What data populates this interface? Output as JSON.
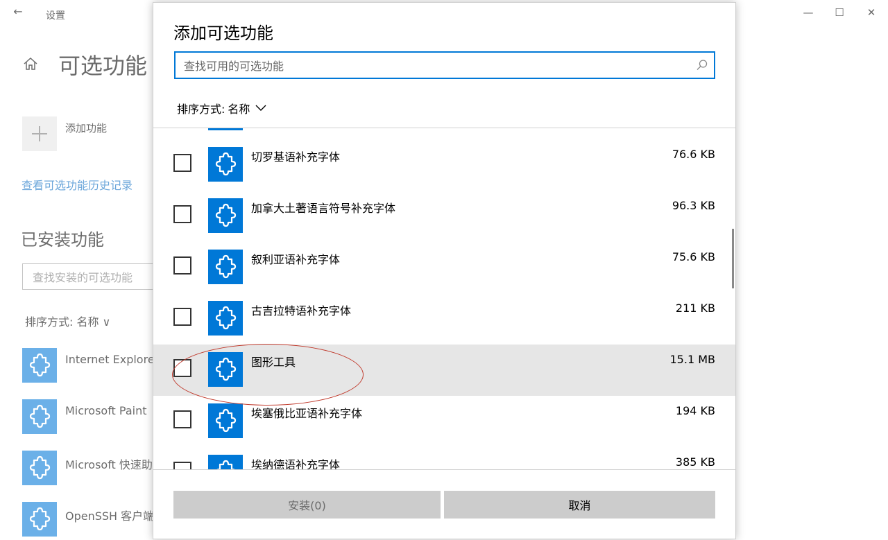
{
  "window": {
    "title": "设置",
    "back_glyph": "←",
    "minimize_glyph": "—",
    "maximize_glyph": "☐",
    "close_glyph": "✕"
  },
  "settings": {
    "page_title": "可选功能",
    "add_feature_label": "添加功能",
    "history_link": "查看可选功能历史记录",
    "installed_title": "已安装功能",
    "installed_search_placeholder": "查找安装的可选功能",
    "installed_sort": "排序方式: 名称 ∨",
    "installed_items": [
      {
        "name": "Internet Explorer"
      },
      {
        "name": "Microsoft Paint"
      },
      {
        "name": "Microsoft 快速助"
      },
      {
        "name": "OpenSSH 客户端"
      }
    ]
  },
  "dialog": {
    "title": "添加可选功能",
    "search_placeholder": "查找可用的可选功能",
    "sort_label": "排序方式:",
    "sort_value": "名称",
    "features": [
      {
        "name": "切罗基语补充字体",
        "size": "76.6 KB",
        "selected": false
      },
      {
        "name": "加拿大土著语言符号补充字体",
        "size": "96.3 KB",
        "selected": false
      },
      {
        "name": "叙利亚语补充字体",
        "size": "75.6 KB",
        "selected": false
      },
      {
        "name": "古吉拉特语补充字体",
        "size": "211 KB",
        "selected": false
      },
      {
        "name": "图形工具",
        "size": "15.1 MB",
        "selected": true
      },
      {
        "name": "埃塞俄比亚语补充字体",
        "size": "194 KB",
        "selected": false
      },
      {
        "name": "埃纳德语补充字体",
        "size": "385 KB",
        "selected": false
      }
    ],
    "install_button": "安装(0)",
    "cancel_button": "取消"
  },
  "colors": {
    "accent": "#0078d7",
    "link": "#0067c0",
    "annotation": "#c0392b",
    "selected_row": "#e6e6e6"
  }
}
